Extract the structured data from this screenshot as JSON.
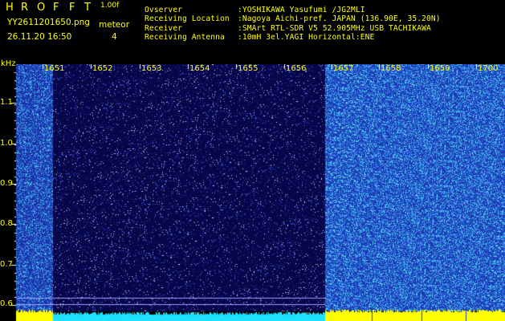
{
  "app": {
    "title_letters": [
      "H",
      "R",
      "O",
      "F",
      "F",
      "T"
    ],
    "version": "1.00f",
    "filename": "YY2611201650.png",
    "datetime": "26.11.20 16:50",
    "event_label": "meteor",
    "event_count": "4"
  },
  "station": [
    {
      "label": "Ovserver",
      "value": ":YOSHIKAWA Yasufumi /JG2MLI"
    },
    {
      "label": "Receiving Location",
      "value": ":Nagoya Aichi-pref. JAPAN (136.90E, 35.20N)"
    },
    {
      "label": "Receiver",
      "value": ":SMArt RTL-SDR V5 52.905MHz USB TACHIKAWA"
    },
    {
      "label": "Receiving Antenna",
      "value": ":10mH 3el.YAGI Horizontal:ENE"
    }
  ],
  "axis": {
    "y_unit": "kHz",
    "y_ticks": [
      "1.1",
      "1.0",
      "0.9",
      "0.8",
      "0.7",
      "0.6"
    ],
    "x_ticks": [
      "1651",
      "1652",
      "1653",
      "1654",
      "1655",
      "1656",
      "1657",
      "1658",
      "1659",
      "1700"
    ]
  },
  "colors": {
    "label_yellow": "#ffff00",
    "spectrum_dark": "#08064a",
    "spectrum_light": "#1b2fa8",
    "dot_cyan": "#30e0ff",
    "dot_white": "#d0d8ff",
    "tick_line": "#9fa0ff"
  }
}
